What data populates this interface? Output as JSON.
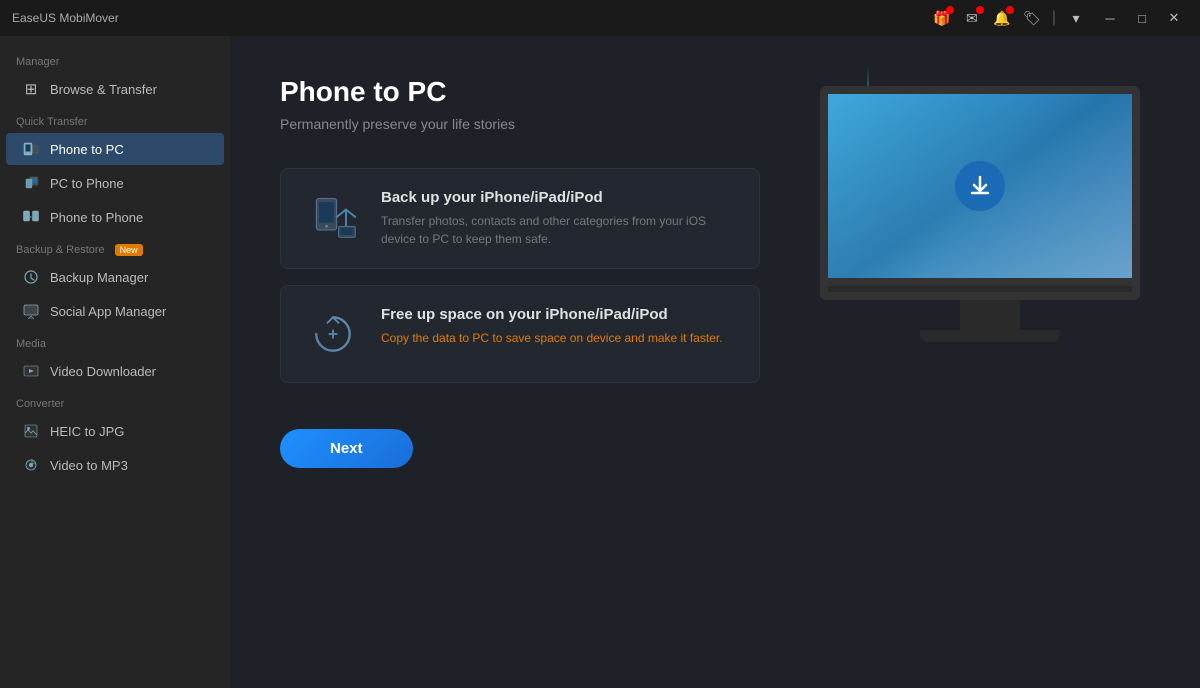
{
  "app": {
    "title": "EaseUS MobiMover"
  },
  "titlebar": {
    "icons": [
      {
        "name": "gift-icon",
        "badge": true
      },
      {
        "name": "email-icon",
        "badge": true
      },
      {
        "name": "bell-icon",
        "badge": true
      },
      {
        "name": "tag-icon",
        "badge": false
      },
      {
        "name": "menu-icon",
        "badge": false
      }
    ],
    "window_controls": [
      {
        "name": "minimize-button",
        "symbol": "─"
      },
      {
        "name": "maximize-button",
        "symbol": "□"
      },
      {
        "name": "close-button",
        "symbol": "✕"
      }
    ]
  },
  "sidebar": {
    "sections": [
      {
        "label": "Manager",
        "items": [
          {
            "id": "browse-transfer",
            "label": "Browse & Transfer",
            "icon": "⊞",
            "active": false
          }
        ]
      },
      {
        "label": "Quick Transfer",
        "items": [
          {
            "id": "phone-to-pc",
            "label": "Phone to PC",
            "icon": "📱",
            "active": true
          },
          {
            "id": "pc-to-phone",
            "label": "PC to Phone",
            "icon": "💻",
            "active": false
          },
          {
            "id": "phone-to-phone",
            "label": "Phone to Phone",
            "icon": "📲",
            "active": false
          }
        ]
      },
      {
        "label": "Backup & Restore",
        "badge": "New",
        "items": [
          {
            "id": "backup-manager",
            "label": "Backup Manager",
            "icon": "🔄",
            "active": false
          },
          {
            "id": "social-app-manager",
            "label": "Social App Manager",
            "icon": "💬",
            "active": false
          }
        ]
      },
      {
        "label": "Media",
        "items": [
          {
            "id": "video-downloader",
            "label": "Video Downloader",
            "icon": "⬇",
            "active": false
          }
        ]
      },
      {
        "label": "Converter",
        "items": [
          {
            "id": "heic-to-jpg",
            "label": "HEIC to JPG",
            "icon": "🖼",
            "active": false
          },
          {
            "id": "video-to-mp3",
            "label": "Video to MP3",
            "icon": "🎵",
            "active": false
          }
        ]
      }
    ]
  },
  "main": {
    "title": "Phone to PC",
    "subtitle": "Permanently preserve your life stories",
    "features": [
      {
        "id": "backup",
        "title": "Back up your iPhone/iPad/iPod",
        "description": "Transfer photos, contacts and other categories from your iOS device to PC to keep them safe.",
        "description_class": ""
      },
      {
        "id": "free-space",
        "title": "Free up space on your iPhone/iPad/iPod",
        "description": "Copy the data to PC to save space on device and make it faster.",
        "description_class": "orange"
      }
    ],
    "next_button": "Next"
  }
}
